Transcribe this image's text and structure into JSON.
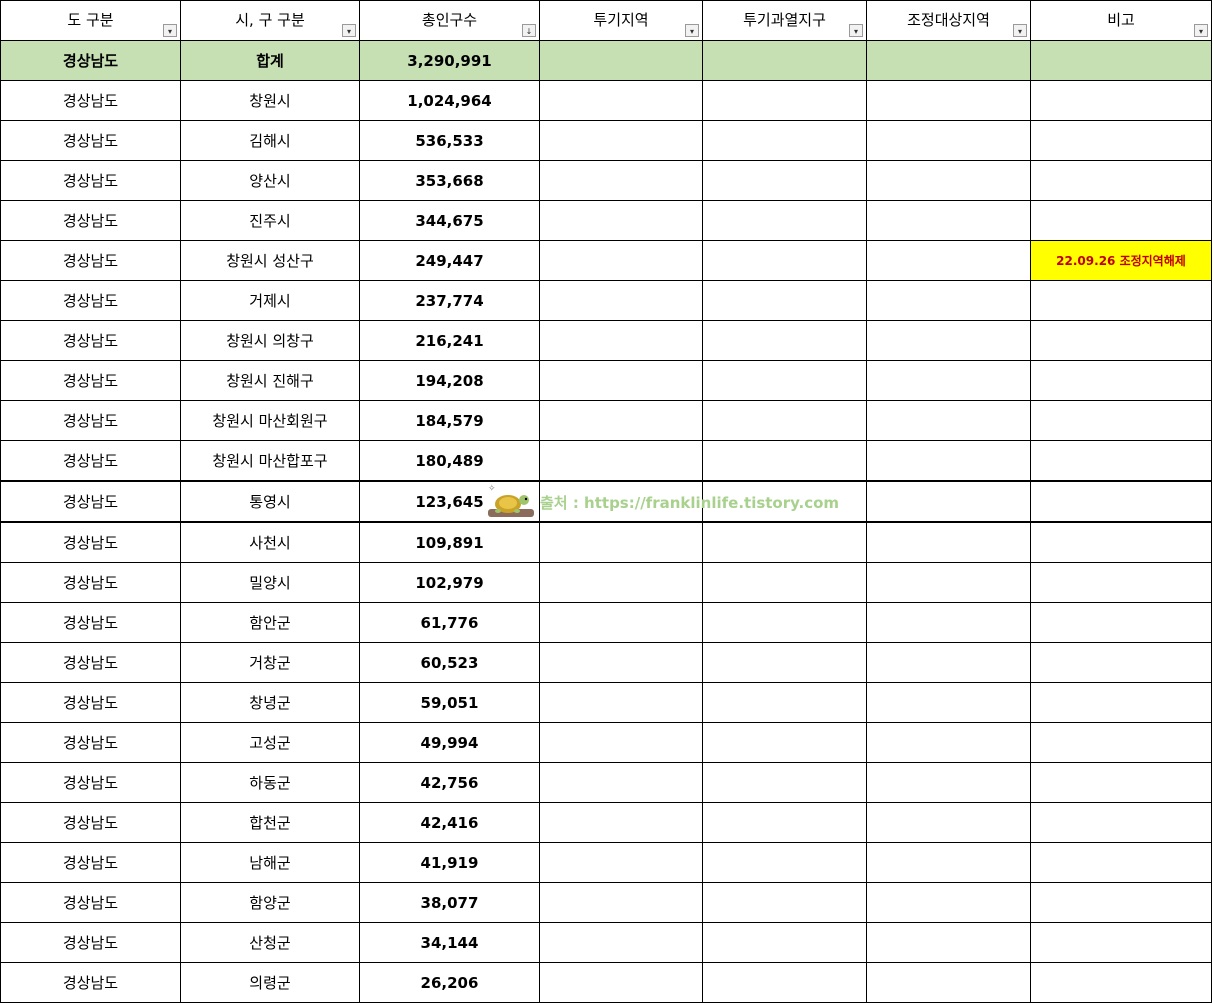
{
  "headers": [
    {
      "label": "도 구분",
      "filter": "▾"
    },
    {
      "label": "시, 구 구분",
      "filter": "▾"
    },
    {
      "label": "총인구수",
      "filter": "↓"
    },
    {
      "label": "투기지역",
      "filter": "▾"
    },
    {
      "label": "투기과열지구",
      "filter": "▾"
    },
    {
      "label": "조정대상지역",
      "filter": "▾"
    },
    {
      "label": "비고",
      "filter": "▾"
    }
  ],
  "rows": [
    {
      "province": "경상남도",
      "city": "합계",
      "population": "3,290,991",
      "speculation": "",
      "overheated": "",
      "adjustment": "",
      "note": ""
    },
    {
      "province": "경상남도",
      "city": "창원시",
      "population": "1,024,964",
      "speculation": "",
      "overheated": "",
      "adjustment": "",
      "note": ""
    },
    {
      "province": "경상남도",
      "city": "김해시",
      "population": "536,533",
      "speculation": "",
      "overheated": "",
      "adjustment": "",
      "note": ""
    },
    {
      "province": "경상남도",
      "city": "양산시",
      "population": "353,668",
      "speculation": "",
      "overheated": "",
      "adjustment": "",
      "note": ""
    },
    {
      "province": "경상남도",
      "city": "진주시",
      "population": "344,675",
      "speculation": "",
      "overheated": "",
      "adjustment": "",
      "note": ""
    },
    {
      "province": "경상남도",
      "city": "창원시 성산구",
      "population": "249,447",
      "speculation": "",
      "overheated": "",
      "adjustment": "",
      "note": "22.09.26 조정지역해제"
    },
    {
      "province": "경상남도",
      "city": "거제시",
      "population": "237,774",
      "speculation": "",
      "overheated": "",
      "adjustment": "",
      "note": ""
    },
    {
      "province": "경상남도",
      "city": "창원시 의창구",
      "population": "216,241",
      "speculation": "",
      "overheated": "",
      "adjustment": "",
      "note": ""
    },
    {
      "province": "경상남도",
      "city": "창원시 진해구",
      "population": "194,208",
      "speculation": "",
      "overheated": "",
      "adjustment": "",
      "note": ""
    },
    {
      "province": "경상남도",
      "city": "창원시 마산회원구",
      "population": "184,579",
      "speculation": "",
      "overheated": "",
      "adjustment": "",
      "note": ""
    },
    {
      "province": "경상남도",
      "city": "창원시 마산합포구",
      "population": "180,489",
      "speculation": "",
      "overheated": "",
      "adjustment": "",
      "note": ""
    },
    {
      "province": "경상남도",
      "city": "통영시",
      "population": "123,645",
      "speculation": "",
      "overheated": "",
      "adjustment": "",
      "note": ""
    },
    {
      "province": "경상남도",
      "city": "사천시",
      "population": "109,891",
      "speculation": "",
      "overheated": "",
      "adjustment": "",
      "note": ""
    },
    {
      "province": "경상남도",
      "city": "밀양시",
      "population": "102,979",
      "speculation": "",
      "overheated": "",
      "adjustment": "",
      "note": ""
    },
    {
      "province": "경상남도",
      "city": "함안군",
      "population": "61,776",
      "speculation": "",
      "overheated": "",
      "adjustment": "",
      "note": ""
    },
    {
      "province": "경상남도",
      "city": "거창군",
      "population": "60,523",
      "speculation": "",
      "overheated": "",
      "adjustment": "",
      "note": ""
    },
    {
      "province": "경상남도",
      "city": "창녕군",
      "population": "59,051",
      "speculation": "",
      "overheated": "",
      "adjustment": "",
      "note": ""
    },
    {
      "province": "경상남도",
      "city": "고성군",
      "population": "49,994",
      "speculation": "",
      "overheated": "",
      "adjustment": "",
      "note": ""
    },
    {
      "province": "경상남도",
      "city": "하동군",
      "population": "42,756",
      "speculation": "",
      "overheated": "",
      "adjustment": "",
      "note": ""
    },
    {
      "province": "경상남도",
      "city": "합천군",
      "population": "42,416",
      "speculation": "",
      "overheated": "",
      "adjustment": "",
      "note": ""
    },
    {
      "province": "경상남도",
      "city": "남해군",
      "population": "41,919",
      "speculation": "",
      "overheated": "",
      "adjustment": "",
      "note": ""
    },
    {
      "province": "경상남도",
      "city": "함양군",
      "population": "38,077",
      "speculation": "",
      "overheated": "",
      "adjustment": "",
      "note": ""
    },
    {
      "province": "경상남도",
      "city": "산청군",
      "population": "34,144",
      "speculation": "",
      "overheated": "",
      "adjustment": "",
      "note": ""
    },
    {
      "province": "경상남도",
      "city": "의령군",
      "population": "26,206",
      "speculation": "",
      "overheated": "",
      "adjustment": "",
      "note": ""
    }
  ],
  "watermark": {
    "text": "출처 : https://franklinlife.tistory.com",
    "icon": "turtle-icon"
  },
  "colors": {
    "total_row_bg": "#c6e0b4",
    "note_bg": "#ffff00",
    "note_text": "#c00000",
    "watermark_text": "#a9d18e"
  }
}
